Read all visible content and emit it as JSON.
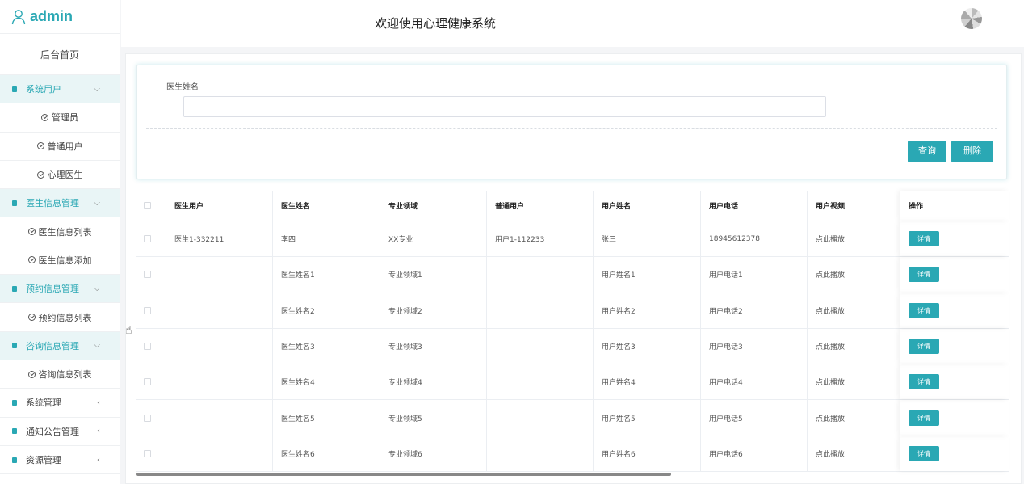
{
  "brand": {
    "name": "admin",
    "icon": "user-icon",
    "accent": "#2aa8b4"
  },
  "sidebar": {
    "home": "后台首页",
    "groups": [
      {
        "label": "系统用户",
        "expanded": true,
        "children": [
          "管理员",
          "普通用户",
          "心理医生"
        ]
      },
      {
        "label": "医生信息管理",
        "expanded": true,
        "children": [
          "医生信息列表",
          "医生信息添加"
        ]
      },
      {
        "label": "预约信息管理",
        "expanded": true,
        "children": [
          "预约信息列表"
        ]
      },
      {
        "label": "咨询信息管理",
        "expanded": true,
        "children": [
          "咨询信息列表"
        ]
      },
      {
        "label": "系统管理",
        "expanded": false,
        "children": []
      },
      {
        "label": "通知公告管理",
        "expanded": false,
        "children": []
      },
      {
        "label": "资源管理",
        "expanded": false,
        "children": []
      }
    ]
  },
  "header": {
    "title": "欢迎使用心理健康系统"
  },
  "search": {
    "label": "医生姓名",
    "value": "",
    "query_button": "查询",
    "delete_button": "删除"
  },
  "table": {
    "columns": [
      "医生用户",
      "医生姓名",
      "专业领域",
      "普通用户",
      "用户姓名",
      "用户电话",
      "用户视频",
      "操作"
    ],
    "rows": [
      [
        "医生1-332211",
        "李四",
        "XX专业",
        "用户1-112233",
        "张三",
        "18945612378",
        "点此播放"
      ],
      [
        "",
        "医生姓名1",
        "专业领域1",
        "",
        "用户姓名1",
        "用户电话1",
        "点此播放"
      ],
      [
        "",
        "医生姓名2",
        "专业领域2",
        "",
        "用户姓名2",
        "用户电话2",
        "点此播放"
      ],
      [
        "",
        "医生姓名3",
        "专业领域3",
        "",
        "用户姓名3",
        "用户电话3",
        "点此播放"
      ],
      [
        "",
        "医生姓名4",
        "专业领域4",
        "",
        "用户姓名4",
        "用户电话4",
        "点此播放"
      ],
      [
        "",
        "医生姓名5",
        "专业领域5",
        "",
        "用户姓名5",
        "用户电话5",
        "点此播放"
      ],
      [
        "",
        "医生姓名6",
        "专业领域6",
        "",
        "用户姓名6",
        "用户电话6",
        "点此播放"
      ]
    ],
    "action_label": "详情"
  }
}
